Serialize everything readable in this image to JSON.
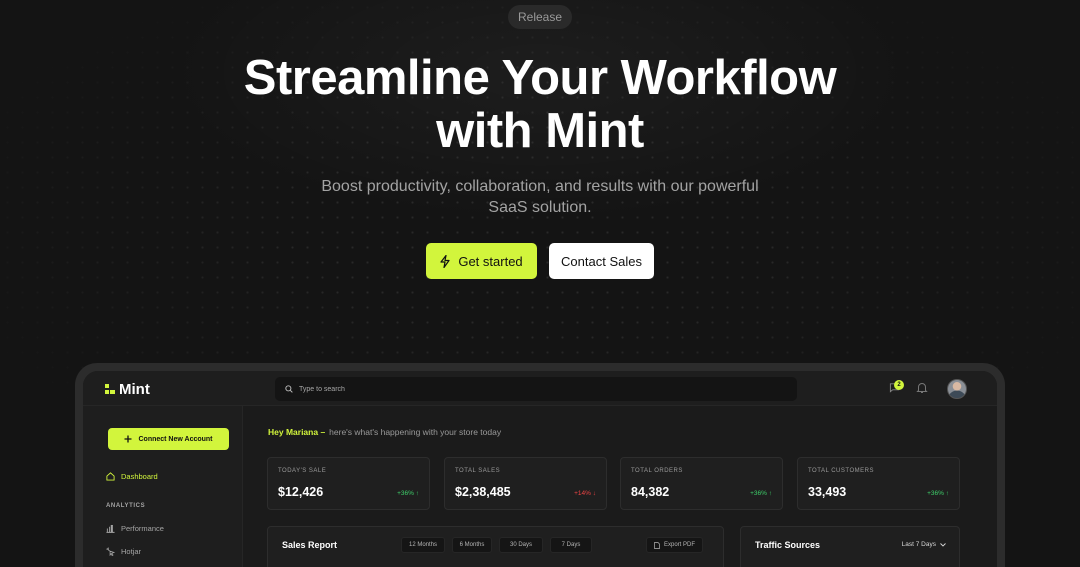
{
  "hero": {
    "pill": "Release",
    "title_line1": "Streamline Your Workflow",
    "title_line2": "with Mint",
    "subtitle_line1": "Boost productivity, collaboration, and results with our powerful",
    "subtitle_line2": "SaaS solution.",
    "primary_cta": "Get started",
    "secondary_cta": "Contact Sales"
  },
  "dashboard": {
    "brand": "Mint",
    "search_placeholder": "Type to search",
    "notification_count": "2",
    "sidebar": {
      "connect_button": "Connect New Account",
      "items": [
        {
          "label": "Dashboard",
          "icon": "home-icon",
          "active": true
        },
        {
          "label": "Performance",
          "icon": "bar-chart-icon"
        },
        {
          "label": "Hotjar",
          "icon": "hotjar-icon"
        }
      ],
      "section_analytics": "ANALYTICS"
    },
    "greeting_name": "Hey Mariana –",
    "greeting_text": "here's what's happening with your store today",
    "stats": [
      {
        "label": "TODAY'S SALE",
        "value": "$12,426",
        "change": "+36% ↑",
        "trend": "up"
      },
      {
        "label": "TOTAL SALES",
        "value": "$2,38,485",
        "change": "+14% ↓",
        "trend": "down"
      },
      {
        "label": "TOTAL ORDERS",
        "value": "84,382",
        "change": "+36% ↑",
        "trend": "up"
      },
      {
        "label": "TOTAL CUSTOMERS",
        "value": "33,493",
        "change": "+36% ↑",
        "trend": "up"
      }
    ],
    "sales_report": {
      "title": "Sales Report",
      "ranges": [
        "12 Months",
        "6 Months",
        "30 Days",
        "7 Days"
      ],
      "export": "Export PDF"
    },
    "traffic": {
      "title": "Traffic Sources",
      "range": "Last 7 Days"
    }
  },
  "colors": {
    "accent": "#d2f53c",
    "background": "#141414",
    "up": "#3ecf6a",
    "down": "#ef4444"
  }
}
